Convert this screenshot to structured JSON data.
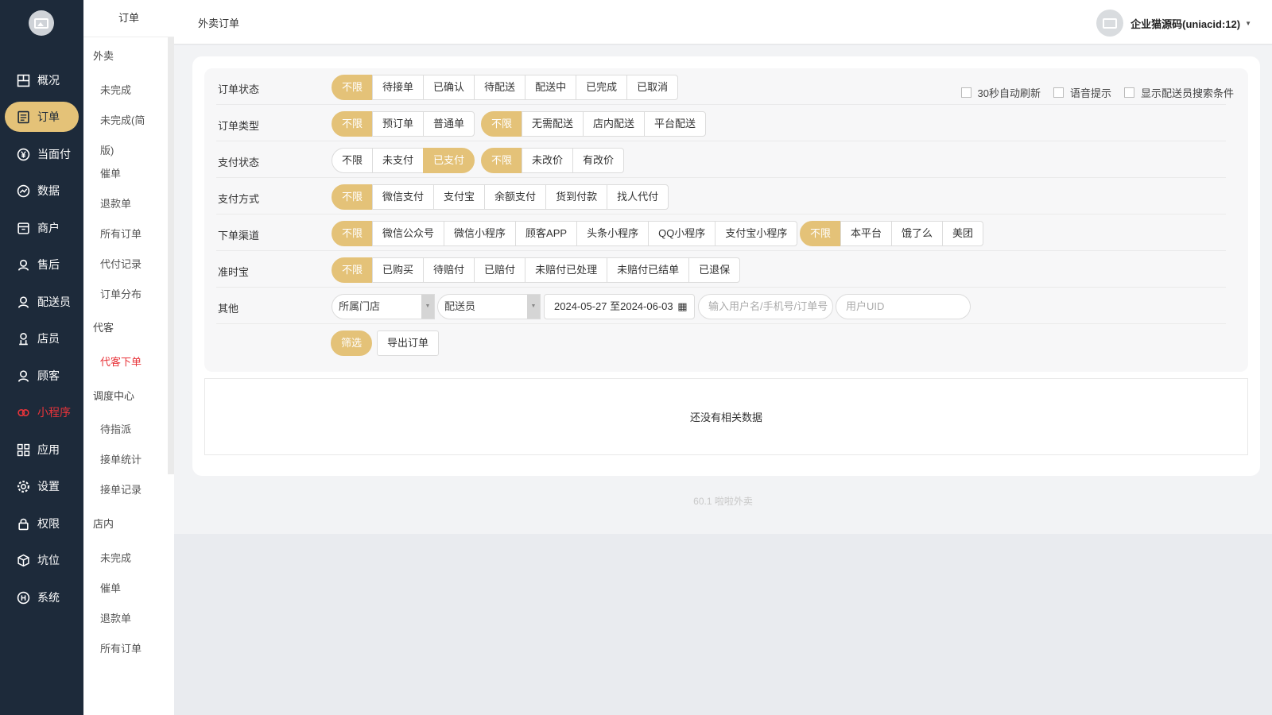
{
  "colors": {
    "nav_bg": "#1d2a3a",
    "accent": "#e4c278",
    "red": "#e8343a"
  },
  "nav": {
    "items": [
      {
        "label": "概况",
        "icon": "overview-icon"
      },
      {
        "label": "订单",
        "icon": "order-icon",
        "active": true
      },
      {
        "label": "当面付",
        "icon": "yen-icon"
      },
      {
        "label": "数据",
        "icon": "chart-icon"
      },
      {
        "label": "商户",
        "icon": "store-icon"
      },
      {
        "label": "售后",
        "icon": "aftersale-icon"
      },
      {
        "label": "配送员",
        "icon": "courier-icon"
      },
      {
        "label": "店员",
        "icon": "clerk-icon"
      },
      {
        "label": "顾客",
        "icon": "customer-icon"
      },
      {
        "label": "小程序",
        "icon": "miniapp-icon",
        "red": true
      },
      {
        "label": "应用",
        "icon": "apps-icon"
      },
      {
        "label": "设置",
        "icon": "gear-icon"
      },
      {
        "label": "权限",
        "icon": "lock-icon"
      },
      {
        "label": "坑位",
        "icon": "box-icon"
      },
      {
        "label": "系统",
        "icon": "system-icon"
      }
    ]
  },
  "subnav": {
    "title": "订单",
    "groups": [
      {
        "label": "外卖"
      },
      {
        "label": "代客"
      },
      {
        "label": "调度中心"
      },
      {
        "label": "店内"
      }
    ],
    "items": [
      "未完成",
      "未完成(简",
      "版)",
      "催单",
      "退款单",
      "所有订单",
      "代付记录",
      "订单分布",
      "代客下单",
      "待指派",
      "接单统计",
      "接单记录",
      "未完成",
      "催单",
      "退款单",
      "所有订单"
    ]
  },
  "header": {
    "title": "外卖订单",
    "user": "企业猫源码(uniacid:12)"
  },
  "filters": {
    "order_status": {
      "label": "订单状态",
      "options": [
        "不限",
        "待接单",
        "已确认",
        "待配送",
        "配送中",
        "已完成",
        "已取消"
      ]
    },
    "order_type": {
      "label": "订单类型",
      "options_a": [
        "不限",
        "预订单",
        "普通单"
      ],
      "options_b": [
        "不限",
        "无需配送",
        "店内配送",
        "平台配送"
      ]
    },
    "pay_status": {
      "label": "支付状态",
      "options_a": [
        "不限",
        "未支付",
        "已支付"
      ],
      "options_b": [
        "不限",
        "未改价",
        "有改价"
      ]
    },
    "pay_method": {
      "label": "支付方式",
      "options": [
        "不限",
        "微信支付",
        "支付宝",
        "余额支付",
        "货到付款",
        "找人代付"
      ]
    },
    "channel": {
      "label": "下单渠道",
      "options_a": [
        "不限",
        "微信公众号",
        "微信小程序",
        "顾客APP",
        "头条小程序",
        "QQ小程序",
        "支付宝小程序"
      ],
      "options_b": [
        "不限",
        "本平台",
        "饿了么",
        "美团"
      ]
    },
    "ontime": {
      "label": "准时宝",
      "options": [
        "不限",
        "已购买",
        "待赔付",
        "已赔付",
        "未赔付已处理",
        "未赔付已结单",
        "已退保"
      ]
    },
    "other": {
      "label": "其他",
      "store_select": "所属门店",
      "courier_select": "配送员",
      "date_range": "2024-05-27 至2024-06-03",
      "search_placeholder": "输入用户名/手机号/订单号",
      "uid_placeholder": "用户UID"
    },
    "checkboxes": [
      "30秒自动刷新",
      "语音提示",
      "显示配送员搜索条件"
    ],
    "filter_button": "筛选",
    "export_button": "导出订单"
  },
  "empty_text": "还没有相关数据",
  "footer": "60.1 啦啦外卖"
}
